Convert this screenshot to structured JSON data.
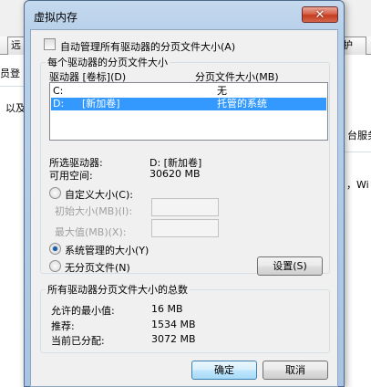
{
  "background": {
    "tabs": [
      "远",
      "护"
    ],
    "left_texts": [
      "员登",
      "以及"
    ],
    "right_texts": [
      "台服务",
      "，Wi"
    ]
  },
  "dialog": {
    "title": "虚拟内存",
    "close_glyph": "✕",
    "auto_manage": {
      "label": "自动管理所有驱动器的分页文件大小(A)",
      "checked": false
    },
    "per_drive_group_title": "每个驱动器的分页文件大小",
    "drive_list": {
      "header_drive": "驱动器 [卷标](D)",
      "header_size": "分页文件大小(MB)",
      "rows": [
        {
          "drive": "C:",
          "label": "",
          "size": "无",
          "selected": false
        },
        {
          "drive": "D:",
          "label": "[新加卷]",
          "size": "托管的系统",
          "selected": true
        }
      ]
    },
    "selected_drive": {
      "label": "所选驱动器:",
      "value": "D:  [新加卷]"
    },
    "free_space": {
      "label": "可用空间:",
      "value": "30620 MB"
    },
    "custom_size": {
      "label": "自定义大小(C):",
      "checked": false
    },
    "initial_size": {
      "label": "初始大小(MB)(I):",
      "value": ""
    },
    "max_size": {
      "label": "最大值(MB)(X):",
      "value": ""
    },
    "system_managed": {
      "label": "系统管理的大小(Y)",
      "checked": true
    },
    "no_paging": {
      "label": "无分页文件(N)",
      "checked": false
    },
    "set_button": "设置(S)",
    "total_group_title": "所有驱动器分页文件大小的总数",
    "totals": {
      "min_label": "允许的最小值:",
      "min_value": "16 MB",
      "recommended_label": "推荐:",
      "recommended_value": "1534 MB",
      "allocated_label": "当前已分配:",
      "allocated_value": "3072 MB"
    },
    "ok_button": "确定",
    "cancel_button": "取消"
  }
}
